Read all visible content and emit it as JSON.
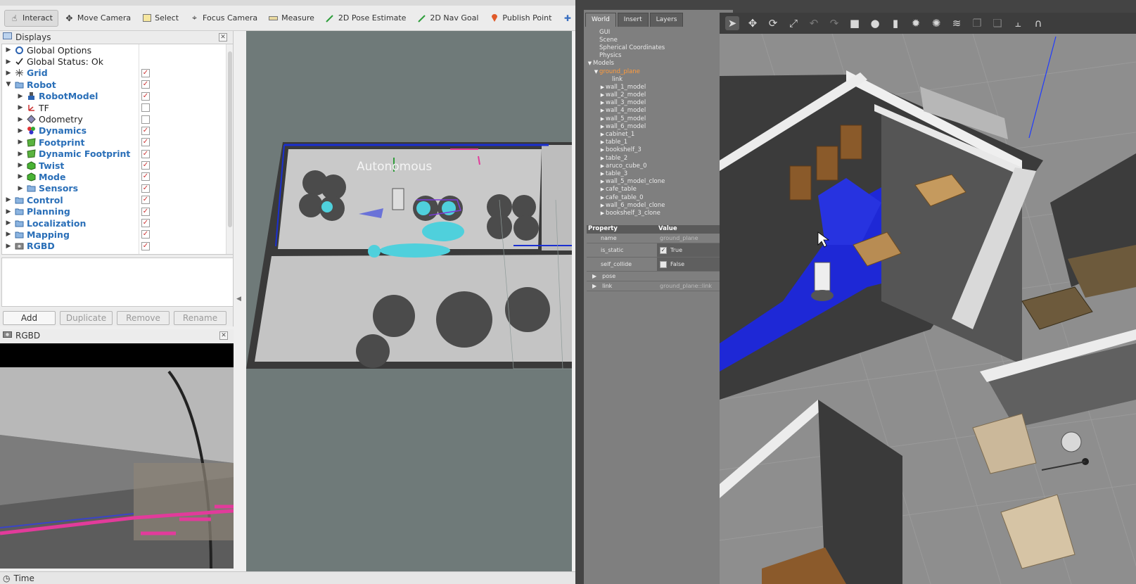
{
  "rviz": {
    "toolbar": [
      {
        "name": "interact-tool",
        "icon": "hand-pointer-icon",
        "label": "Interact",
        "active": true
      },
      {
        "name": "move-camera-tool",
        "icon": "move-camera-icon",
        "label": "Move Camera"
      },
      {
        "name": "select-tool",
        "icon": "select-box-icon",
        "label": "Select"
      },
      {
        "name": "focus-camera-tool",
        "icon": "focus-target-icon",
        "label": "Focus Camera"
      },
      {
        "name": "measure-tool",
        "icon": "ruler-icon",
        "label": "Measure"
      },
      {
        "name": "pose-estimate-tool",
        "icon": "green-arrow-icon",
        "label": "2D Pose Estimate"
      },
      {
        "name": "nav-goal-tool",
        "icon": "green-arrow-icon",
        "label": "2D Nav Goal"
      },
      {
        "name": "publish-point-tool",
        "icon": "map-pin-icon",
        "label": "Publish Point"
      }
    ],
    "displays": {
      "title": "Displays",
      "items": [
        {
          "label": "Global Options",
          "indent": 0,
          "icon": "gear-icon",
          "blue": false,
          "check": null
        },
        {
          "label": "Global Status: Ok",
          "indent": 0,
          "icon": "checkmark-icon",
          "blue": false,
          "check": null
        },
        {
          "label": "Grid",
          "indent": 0,
          "icon": "grid-icon",
          "blue": true,
          "check": true
        },
        {
          "label": "Robot",
          "indent": 0,
          "icon": "folder-icon",
          "blue": true,
          "check": true,
          "expanded": true
        },
        {
          "label": "RobotModel",
          "indent": 1,
          "icon": "robot-model-icon",
          "blue": true,
          "check": true
        },
        {
          "label": "TF",
          "indent": 1,
          "icon": "tf-axes-icon",
          "blue": false,
          "check": false
        },
        {
          "label": "Odometry",
          "indent": 1,
          "icon": "diamond-icon",
          "blue": false,
          "check": false
        },
        {
          "label": "Dynamics",
          "indent": 1,
          "icon": "dynamics-icon",
          "blue": true,
          "check": true
        },
        {
          "label": "Footprint",
          "indent": 1,
          "icon": "polygon-icon",
          "blue": true,
          "check": true
        },
        {
          "label": "Dynamic Footprint",
          "indent": 1,
          "icon": "polygon-icon",
          "blue": true,
          "check": true
        },
        {
          "label": "Twist",
          "indent": 1,
          "icon": "marker-cube-icon",
          "blue": true,
          "check": true
        },
        {
          "label": "Mode",
          "indent": 1,
          "icon": "marker-cube-icon",
          "blue": true,
          "check": true
        },
        {
          "label": "Sensors",
          "indent": 1,
          "icon": "folder-icon",
          "blue": true,
          "check": true
        },
        {
          "label": "Control",
          "indent": 0,
          "icon": "folder-icon",
          "blue": true,
          "check": true
        },
        {
          "label": "Planning",
          "indent": 0,
          "icon": "folder-icon",
          "blue": true,
          "check": true
        },
        {
          "label": "Localization",
          "indent": 0,
          "icon": "folder-icon",
          "blue": true,
          "check": true
        },
        {
          "label": "Mapping",
          "indent": 0,
          "icon": "folder-icon",
          "blue": true,
          "check": true
        },
        {
          "label": "RGBD",
          "indent": 0,
          "icon": "camera-icon",
          "blue": true,
          "check": true
        }
      ],
      "buttons": [
        {
          "label": "Add",
          "enabled": true
        },
        {
          "label": "Duplicate",
          "enabled": false
        },
        {
          "label": "Remove",
          "enabled": false
        },
        {
          "label": "Rename",
          "enabled": false
        }
      ]
    },
    "rgbd_panel": {
      "title": "RGBD"
    },
    "map_overlay_text": "Autonomous",
    "time_bar": {
      "label": "Time"
    }
  },
  "gazebo": {
    "tabs": [
      {
        "label": "World",
        "active": true
      },
      {
        "label": "Insert",
        "active": false
      },
      {
        "label": "Layers",
        "active": false
      }
    ],
    "world_tree": [
      {
        "label": "GUI",
        "indent": 1,
        "arrow": ""
      },
      {
        "label": "Scene",
        "indent": 1,
        "arrow": ""
      },
      {
        "label": "Spherical Coordinates",
        "indent": 1,
        "arrow": ""
      },
      {
        "label": "Physics",
        "indent": 1,
        "arrow": ""
      },
      {
        "label": "Models",
        "indent": 0,
        "arrow": "▼"
      },
      {
        "label": "ground_plane",
        "indent": 1,
        "arrow": "▼",
        "selected": true
      },
      {
        "label": "link",
        "indent": 3,
        "arrow": ""
      },
      {
        "label": "wall_1_model",
        "indent": 2,
        "arrow": "▶"
      },
      {
        "label": "wall_2_model",
        "indent": 2,
        "arrow": "▶"
      },
      {
        "label": "wall_3_model",
        "indent": 2,
        "arrow": "▶"
      },
      {
        "label": "wall_4_model",
        "indent": 2,
        "arrow": "▶"
      },
      {
        "label": "wall_5_model",
        "indent": 2,
        "arrow": "▶"
      },
      {
        "label": "wall_6_model",
        "indent": 2,
        "arrow": "▶"
      },
      {
        "label": "cabinet_1",
        "indent": 2,
        "arrow": "▶"
      },
      {
        "label": "table_1",
        "indent": 2,
        "arrow": "▶"
      },
      {
        "label": "bookshelf_3",
        "indent": 2,
        "arrow": "▶"
      },
      {
        "label": "table_2",
        "indent": 2,
        "arrow": "▶"
      },
      {
        "label": "aruco_cube_0",
        "indent": 2,
        "arrow": "▶"
      },
      {
        "label": "table_3",
        "indent": 2,
        "arrow": "▶"
      },
      {
        "label": "wall_5_model_clone",
        "indent": 2,
        "arrow": "▶"
      },
      {
        "label": "cafe_table",
        "indent": 2,
        "arrow": "▶"
      },
      {
        "label": "cafe_table_0",
        "indent": 2,
        "arrow": "▶"
      },
      {
        "label": "wall_6_model_clone",
        "indent": 2,
        "arrow": "▶"
      },
      {
        "label": "bookshelf_3_clone",
        "indent": 2,
        "arrow": "▶"
      }
    ],
    "properties": {
      "header": {
        "property": "Property",
        "value": "Value"
      },
      "name": {
        "key": "name",
        "value": "ground_plane"
      },
      "is_static": {
        "key": "is_static",
        "value": "True",
        "checked": true
      },
      "self_collide": {
        "key": "self_collide",
        "value": "False",
        "checked": false
      },
      "pose": {
        "key": "pose"
      },
      "link": {
        "key": "link",
        "value": "ground_plane::link"
      }
    },
    "toolbar_icons": [
      "select-arrow-icon",
      "translate-icon",
      "rotate-icon",
      "scale-icon",
      "undo-icon",
      "redo-icon",
      "box-shape-icon",
      "sphere-shape-icon",
      "cylinder-shape-icon",
      "sun-light-icon",
      "point-light-icon",
      "spot-light-icon",
      "copy-icon",
      "paste-icon",
      "align-icon",
      "snap-magnet-icon"
    ]
  }
}
